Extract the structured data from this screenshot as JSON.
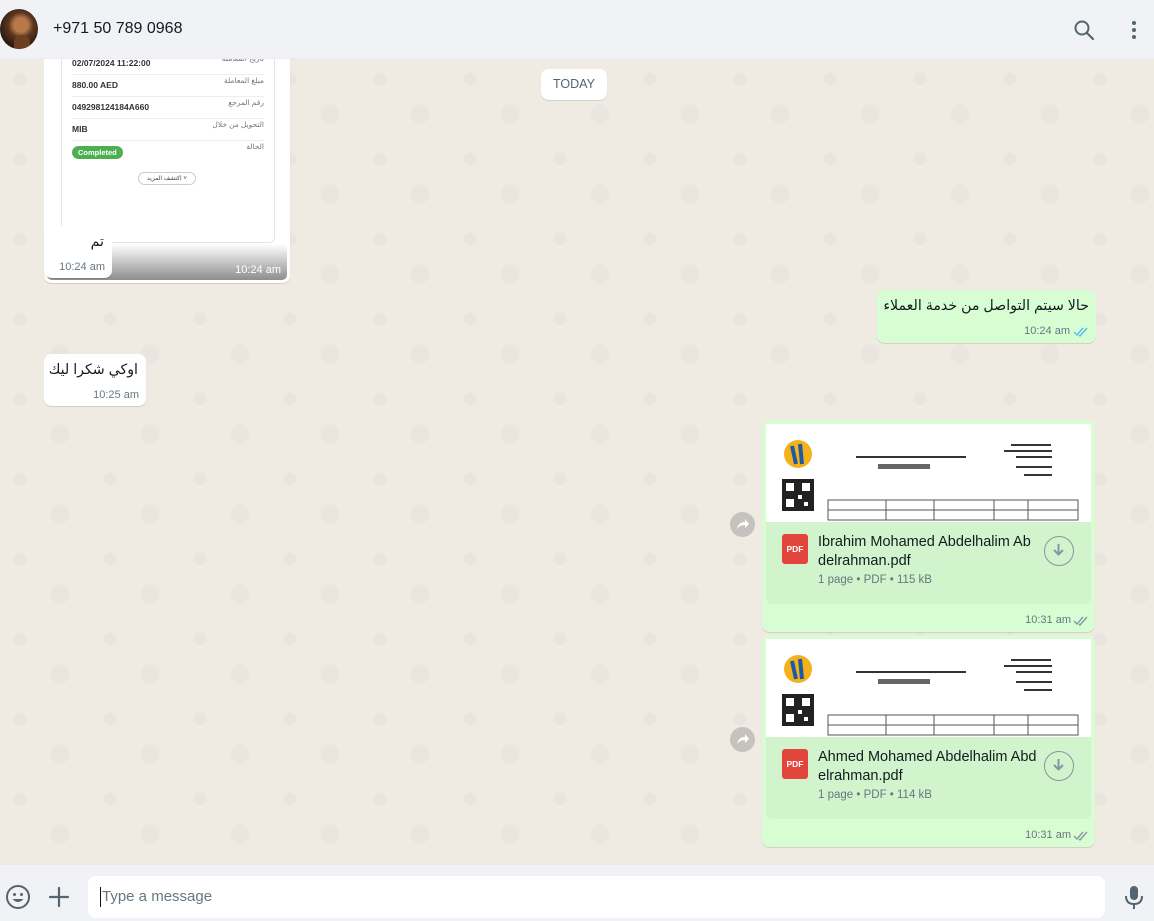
{
  "header": {
    "contact_name": "+971 50 789 0968"
  },
  "chat": {
    "date_chip": "TODAY",
    "receipt": {
      "rows": [
        {
          "value": "02/07/2024 11:22:00",
          "key": "تاريخ المعاملة"
        },
        {
          "value": "880.00 AED",
          "key": "مبلغ المعاملة"
        },
        {
          "value": "049298124184A660",
          "key": "رقم المرجع"
        },
        {
          "value": "MIB",
          "key": "التحويل من خلال"
        }
      ],
      "status_key": "الحالة",
      "status_value": "Completed",
      "more_label": "اكتشف المزيد",
      "time": "10:24 am"
    },
    "messages": [
      {
        "text": "تم",
        "time": "10:24 am"
      },
      {
        "text": "حالا سيتم التواصل من خدمة العملاء",
        "time": "10:24 am"
      },
      {
        "text": "اوكي شكرا ليك",
        "time": "10:25 am"
      }
    ],
    "documents": [
      {
        "name": "Ibrahim Mohamed Abdelhalim Abdelrahman.pdf",
        "meta": "1 page • PDF • 115 kB",
        "time": "10:31 am",
        "icon_label": "PDF"
      },
      {
        "name": "Ahmed Mohamed Abdelhalim Abdelrahman.pdf",
        "meta": "1 page • PDF • 114 kB",
        "time": "10:31 am",
        "icon_label": "PDF"
      }
    ]
  },
  "composer": {
    "placeholder": "Type a message"
  },
  "colors": {
    "incoming": "#ffffff",
    "outgoing": "#d9fdd3",
    "background": "#efeae2",
    "read_tick": "#53bdeb",
    "pdf_red": "#e2453c"
  },
  "icons": [
    "search-icon",
    "menu-icon",
    "forward-icon",
    "download-icon",
    "pdf-icon",
    "emoji-icon",
    "plus-icon",
    "mic-icon",
    "double-check-icon"
  ]
}
